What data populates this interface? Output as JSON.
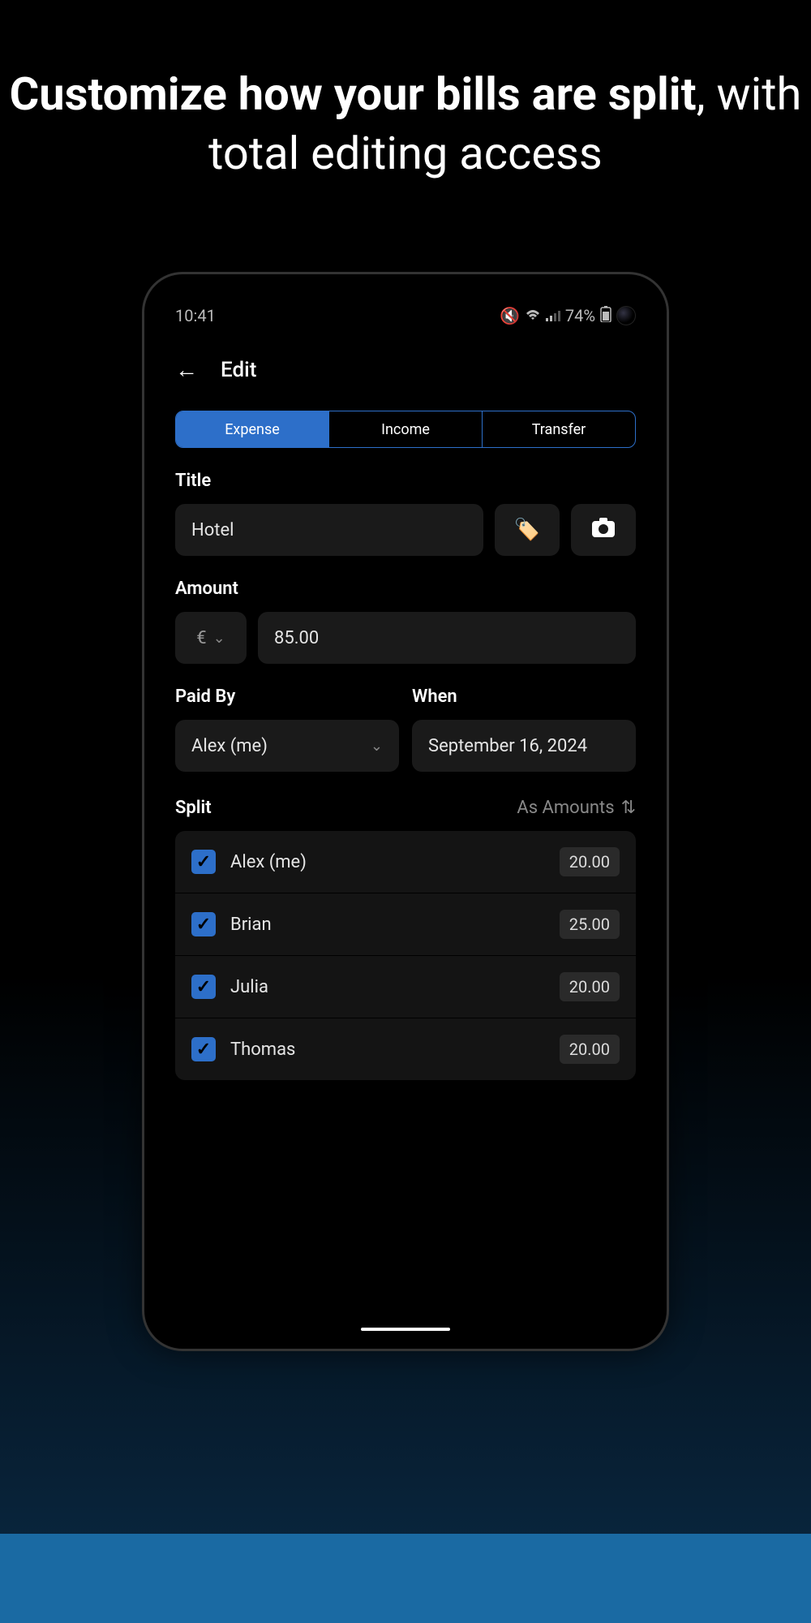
{
  "marketing": {
    "bold": "Customize how your bills are split",
    "rest": ", with total editing access"
  },
  "status": {
    "time": "10:41",
    "battery": "74%"
  },
  "header": {
    "title": "Edit"
  },
  "tabs": {
    "items": [
      "Expense",
      "Income",
      "Transfer"
    ],
    "active_index": 0
  },
  "form": {
    "title_label": "Title",
    "title_value": "Hotel",
    "amount_label": "Amount",
    "currency": "€",
    "amount_value": "85.00",
    "paidby_label": "Paid By",
    "paidby_value": "Alex (me)",
    "when_label": "When",
    "when_value": "September 16, 2024"
  },
  "split": {
    "label": "Split",
    "mode": "As Amounts",
    "people": [
      {
        "name": "Alex (me)",
        "amount": "20.00",
        "checked": true
      },
      {
        "name": "Brian",
        "amount": "25.00",
        "checked": true
      },
      {
        "name": "Julia",
        "amount": "20.00",
        "checked": true
      },
      {
        "name": "Thomas",
        "amount": "20.00",
        "checked": true
      }
    ]
  },
  "colors": {
    "accent": "#2d6fc9"
  }
}
